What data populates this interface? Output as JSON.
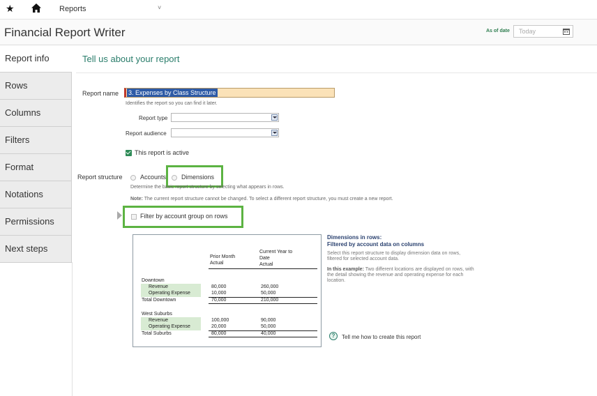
{
  "topbar": {
    "crumb": "Reports",
    "chev": "˅"
  },
  "header": {
    "title": "Financial Report Writer",
    "asof_label": "As of date",
    "date_placeholder": "Today"
  },
  "sidebar": {
    "items": [
      {
        "label": "Report info",
        "active": true
      },
      {
        "label": "Rows"
      },
      {
        "label": "Columns"
      },
      {
        "label": "Filters"
      },
      {
        "label": "Format"
      },
      {
        "label": "Notations"
      },
      {
        "label": "Permissions"
      },
      {
        "label": "Next steps"
      }
    ]
  },
  "panel": {
    "title": "Tell us about your report",
    "report_name_label": "Report name",
    "report_name_value": "3. Expenses by Class Structure",
    "report_name_hint": "Identifies the report so you can find it later.",
    "report_type_label": "Report type",
    "report_audience_label": "Report audience",
    "active_label": "This report is active",
    "structure_label": "Report structure",
    "accounts_label": "Accounts",
    "dimensions_label": "Dimensions",
    "structure_hint": "Determine the basic report structure by selecting what appears in rows.",
    "note_bold": "Note:",
    "note_text": " The current report structure cannot be changed. To select a different report structure, you must create a new report.",
    "filter_label": "Filter by account group on rows"
  },
  "example": {
    "col1": [
      "Prior Month",
      "Actual"
    ],
    "col2": [
      "Current Year to",
      "Date",
      "Actual"
    ],
    "groups": [
      {
        "name": "Downtown",
        "rows": [
          {
            "label": "Revenue",
            "v1": "80,000",
            "v2": "260,000"
          },
          {
            "label": "Operating Expense",
            "v1": "10,000",
            "v2": "50,000"
          }
        ],
        "total_label": "Total Downtown",
        "t1": "70,000",
        "t2": "210,000"
      },
      {
        "name": "West Suburbs",
        "rows": [
          {
            "label": "Revenue",
            "v1": "100,000",
            "v2": "90,000"
          },
          {
            "label": "Operating Expense",
            "v1": "20,000",
            "v2": "50,000"
          }
        ],
        "total_label": "Total Suburbs",
        "t1": "80,000",
        "t2": "40,000"
      }
    ]
  },
  "info": {
    "title1": "Dimensions in rows:",
    "title2": "Filtered by account data on columns",
    "p1a": "Select this report structure to display dimension data on rows,",
    "p1b": "filtered for selected account data.",
    "p2_bold": "In this example:",
    "p2a": " Two different locations are displayed on rows, with",
    "p2b": "the detail showing the revenue and operating expense for each",
    "p2c": "location.",
    "help_link": "Tell me how to create this report",
    "help_glyph": "?"
  },
  "colors": {
    "accent": "#2a7d6b",
    "highlight": "#5cb342",
    "name_bg": "#fbe2b8"
  }
}
